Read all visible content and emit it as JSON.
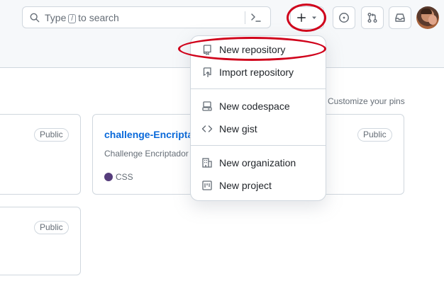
{
  "header": {
    "search": {
      "placeholder_pre": "Type",
      "placeholder_key": "/",
      "placeholder_post": "to search"
    },
    "create_button_icon": "plus-icon",
    "buttons": [
      "issues-icon",
      "pull-request-icon",
      "inbox-icon"
    ]
  },
  "pins": {
    "customize_label": "Customize your pins",
    "cards": [
      {
        "visibility": "Public"
      },
      {
        "title": "challenge-Encriptador-de-texto",
        "description": "Challenge Encriptador de texto",
        "visibility": "Public",
        "language": "CSS",
        "language_color": "#563d7c"
      },
      {
        "visibility": "Public"
      }
    ]
  },
  "create_menu": {
    "items": [
      {
        "label": "New repository",
        "icon": "repo-icon"
      },
      {
        "label": "Import repository",
        "icon": "repo-push-icon"
      },
      {
        "label": "New codespace",
        "icon": "codespaces-icon"
      },
      {
        "label": "New gist",
        "icon": "code-icon"
      },
      {
        "label": "New organization",
        "icon": "organization-icon"
      },
      {
        "label": "New project",
        "icon": "project-icon"
      }
    ]
  },
  "colors": {
    "accent": "#0969da",
    "annotation": "#d0021b",
    "border": "#d0d7de"
  }
}
